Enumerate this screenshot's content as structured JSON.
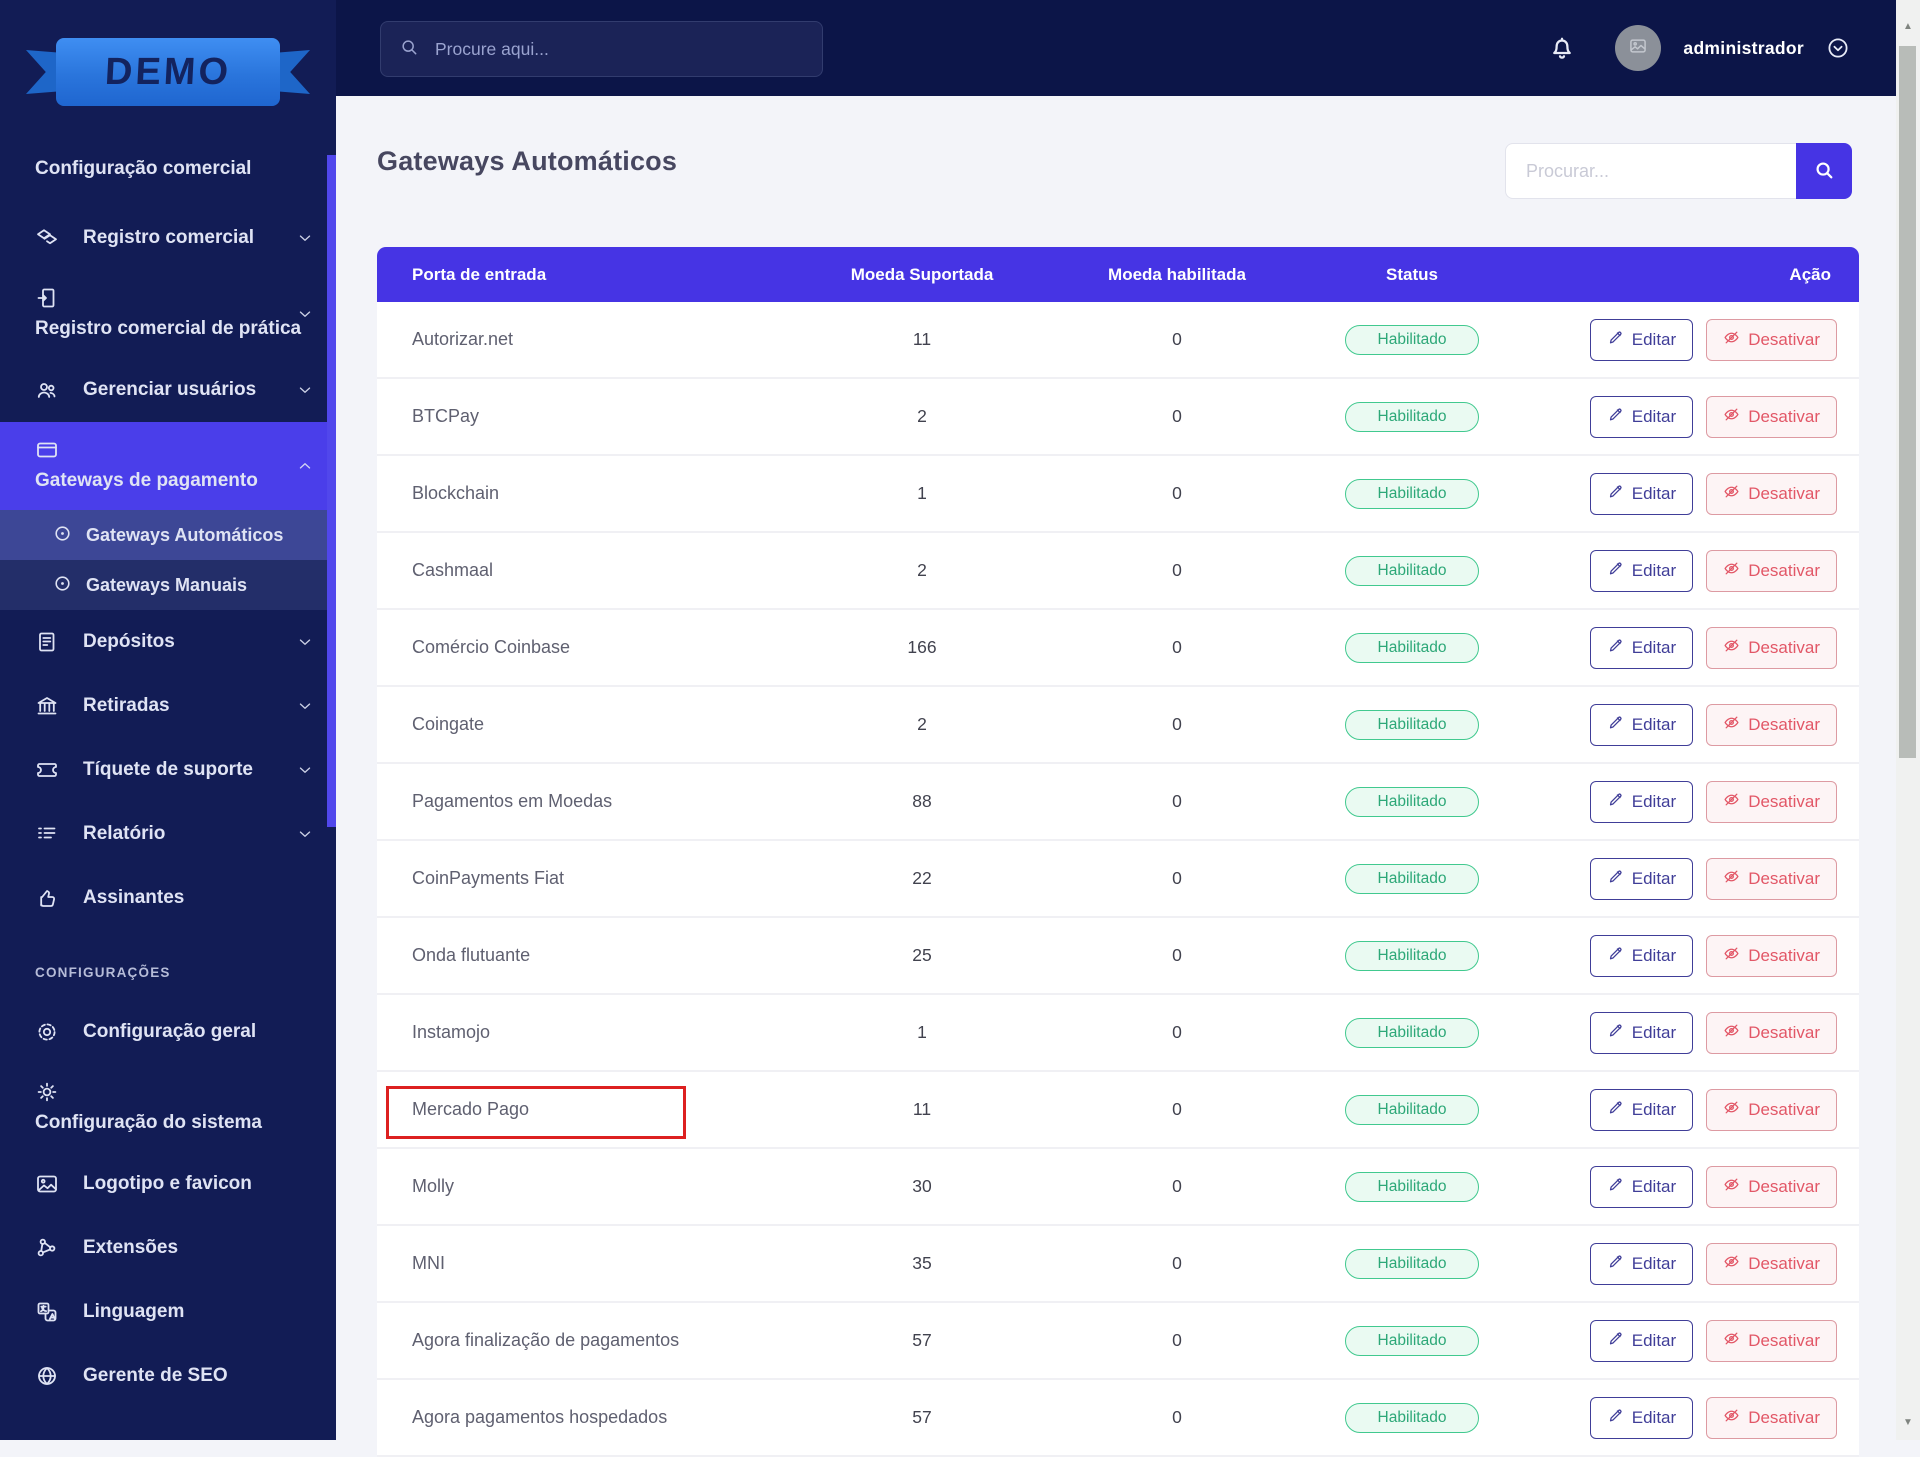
{
  "colors": {
    "accent": "#4634e4",
    "green": "#2da878",
    "red": "#dd2020",
    "danger": "#e25767",
    "sidebar": "#121c55",
    "topbar": "#0c1548"
  },
  "sidebar": {
    "logo_text": "DEMO",
    "items": [
      {
        "id": "configuracao-comercial",
        "label": "Configuração comercial",
        "type": "plain"
      },
      {
        "id": "registro-comercial",
        "label": "Registro comercial",
        "icon": "tags",
        "chevron": "down"
      },
      {
        "id": "registro-comercial-de-pratica",
        "label": "Registro comercial de prática",
        "icon": "door",
        "chevron": "down",
        "stacked": true
      },
      {
        "id": "gerenciar-usuarios",
        "label": "Gerenciar usuários",
        "icon": "users",
        "chevron": "down"
      },
      {
        "id": "gateways-de-pagamento",
        "label": "Gateways de pagamento",
        "icon": "card",
        "chevron": "up",
        "stacked": true,
        "active": true
      },
      {
        "id": "gateways-automaticos",
        "label": "Gateways Automáticos",
        "icon": "target",
        "sub": true,
        "subactive": true
      },
      {
        "id": "gateways-manuais",
        "label": "Gateways Manuais",
        "icon": "target",
        "sub": true
      },
      {
        "id": "depositos",
        "label": "Depósitos",
        "icon": "deposit",
        "chevron": "down"
      },
      {
        "id": "retiradas",
        "label": "Retiradas",
        "icon": "bank",
        "chevron": "down"
      },
      {
        "id": "tiquete-de-suporte",
        "label": "Tíquete de suporte",
        "icon": "ticket",
        "chevron": "down"
      },
      {
        "id": "relatorio",
        "label": "Relatório",
        "icon": "report",
        "chevron": "down"
      },
      {
        "id": "assinantes",
        "label": "Assinantes",
        "icon": "thumb"
      },
      {
        "id": "configuracoes-header",
        "label": "CONFIGURAÇÕES",
        "type": "section"
      },
      {
        "id": "configuracao-geral",
        "label": "Configuração geral",
        "icon": "general"
      },
      {
        "id": "configuracao-do-sistema",
        "label": "Configuração do sistema",
        "icon": "gear",
        "stacked": true
      },
      {
        "id": "logotipo-e-favicon",
        "label": "Logotipo e favicon",
        "icon": "image"
      },
      {
        "id": "extensoes",
        "label": "Extensões",
        "icon": "share"
      },
      {
        "id": "linguagem",
        "label": "Linguagem",
        "icon": "language"
      },
      {
        "id": "gerente-de-seo",
        "label": "Gerente de SEO",
        "icon": "globe"
      }
    ]
  },
  "topbar": {
    "search_placeholder": "Procure aqui...",
    "username": "administrador"
  },
  "page": {
    "title": "Gateways Automáticos",
    "search_placeholder": "Procurar..."
  },
  "table": {
    "columns": [
      "Porta de entrada",
      "Moeda Suportada",
      "Moeda habilitada",
      "Status",
      "Ação"
    ],
    "actions": {
      "edit": "Editar",
      "disable": "Desativar"
    },
    "rows": [
      {
        "name": "Autorizar.net",
        "supported": "11",
        "enabled": "0",
        "status": "Habilitado"
      },
      {
        "name": "BTCPay",
        "supported": "2",
        "enabled": "0",
        "status": "Habilitado"
      },
      {
        "name": "Blockchain",
        "supported": "1",
        "enabled": "0",
        "status": "Habilitado"
      },
      {
        "name": "Cashmaal",
        "supported": "2",
        "enabled": "0",
        "status": "Habilitado"
      },
      {
        "name": "Comércio Coinbase",
        "supported": "166",
        "enabled": "0",
        "status": "Habilitado"
      },
      {
        "name": "Coingate",
        "supported": "2",
        "enabled": "0",
        "status": "Habilitado"
      },
      {
        "name": "Pagamentos em Moedas",
        "supported": "88",
        "enabled": "0",
        "status": "Habilitado"
      },
      {
        "name": "CoinPayments Fiat",
        "supported": "22",
        "enabled": "0",
        "status": "Habilitado"
      },
      {
        "name": "Onda flutuante",
        "supported": "25",
        "enabled": "0",
        "status": "Habilitado"
      },
      {
        "name": "Instamojo",
        "supported": "1",
        "enabled": "0",
        "status": "Habilitado"
      },
      {
        "name": "Mercado Pago",
        "supported": "11",
        "enabled": "0",
        "status": "Habilitado",
        "highlighted": true
      },
      {
        "name": "Molly",
        "supported": "30",
        "enabled": "0",
        "status": "Habilitado"
      },
      {
        "name": "MNI",
        "supported": "35",
        "enabled": "0",
        "status": "Habilitado"
      },
      {
        "name": "Agora finalização de pagamentos",
        "supported": "57",
        "enabled": "0",
        "status": "Habilitado"
      },
      {
        "name": "Agora pagamentos hospedados",
        "supported": "57",
        "enabled": "0",
        "status": "Habilitado"
      }
    ]
  }
}
